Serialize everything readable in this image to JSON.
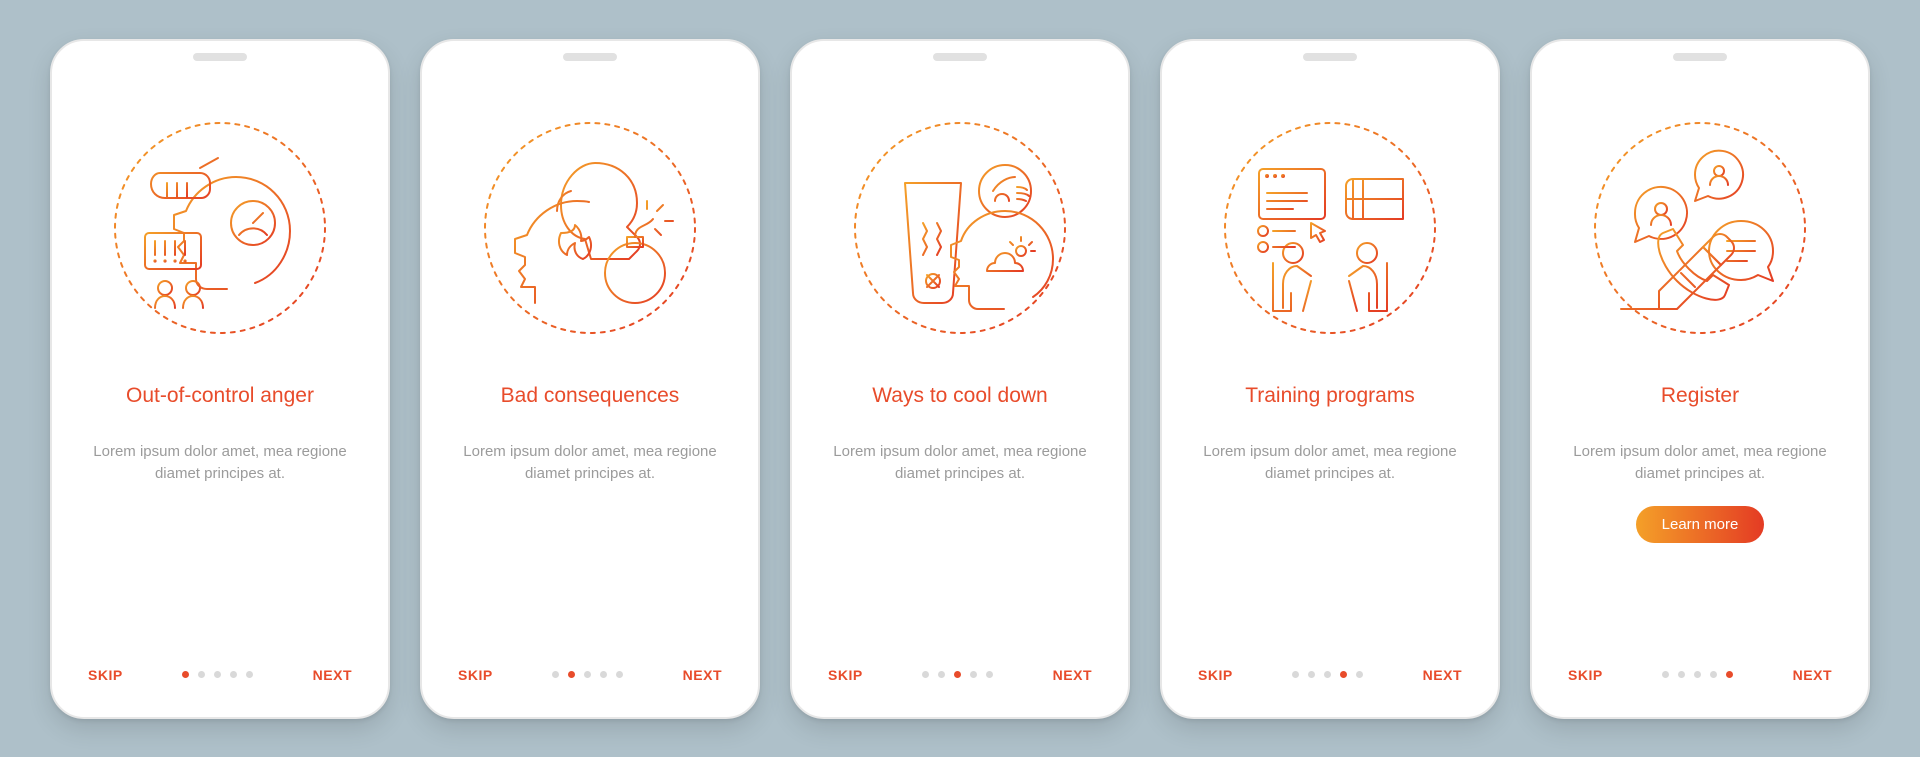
{
  "common": {
    "skip_label": "SKIP",
    "next_label": "NEXT",
    "description": "Lorem ipsum dolor amet, mea regione diamet principes at.",
    "learn_more_label": "Learn more",
    "dot_count": 5
  },
  "screens": [
    {
      "title": "Out-of-control anger",
      "illus": "anger",
      "active_dot": 0,
      "has_cta": false
    },
    {
      "title": "Bad consequences",
      "illus": "bad",
      "active_dot": 1,
      "has_cta": false
    },
    {
      "title": "Ways to cool down",
      "illus": "cool",
      "active_dot": 2,
      "has_cta": false
    },
    {
      "title": "Training programs",
      "illus": "training",
      "active_dot": 3,
      "has_cta": false
    },
    {
      "title": "Register",
      "illus": "register",
      "active_dot": 4,
      "has_cta": true
    }
  ]
}
